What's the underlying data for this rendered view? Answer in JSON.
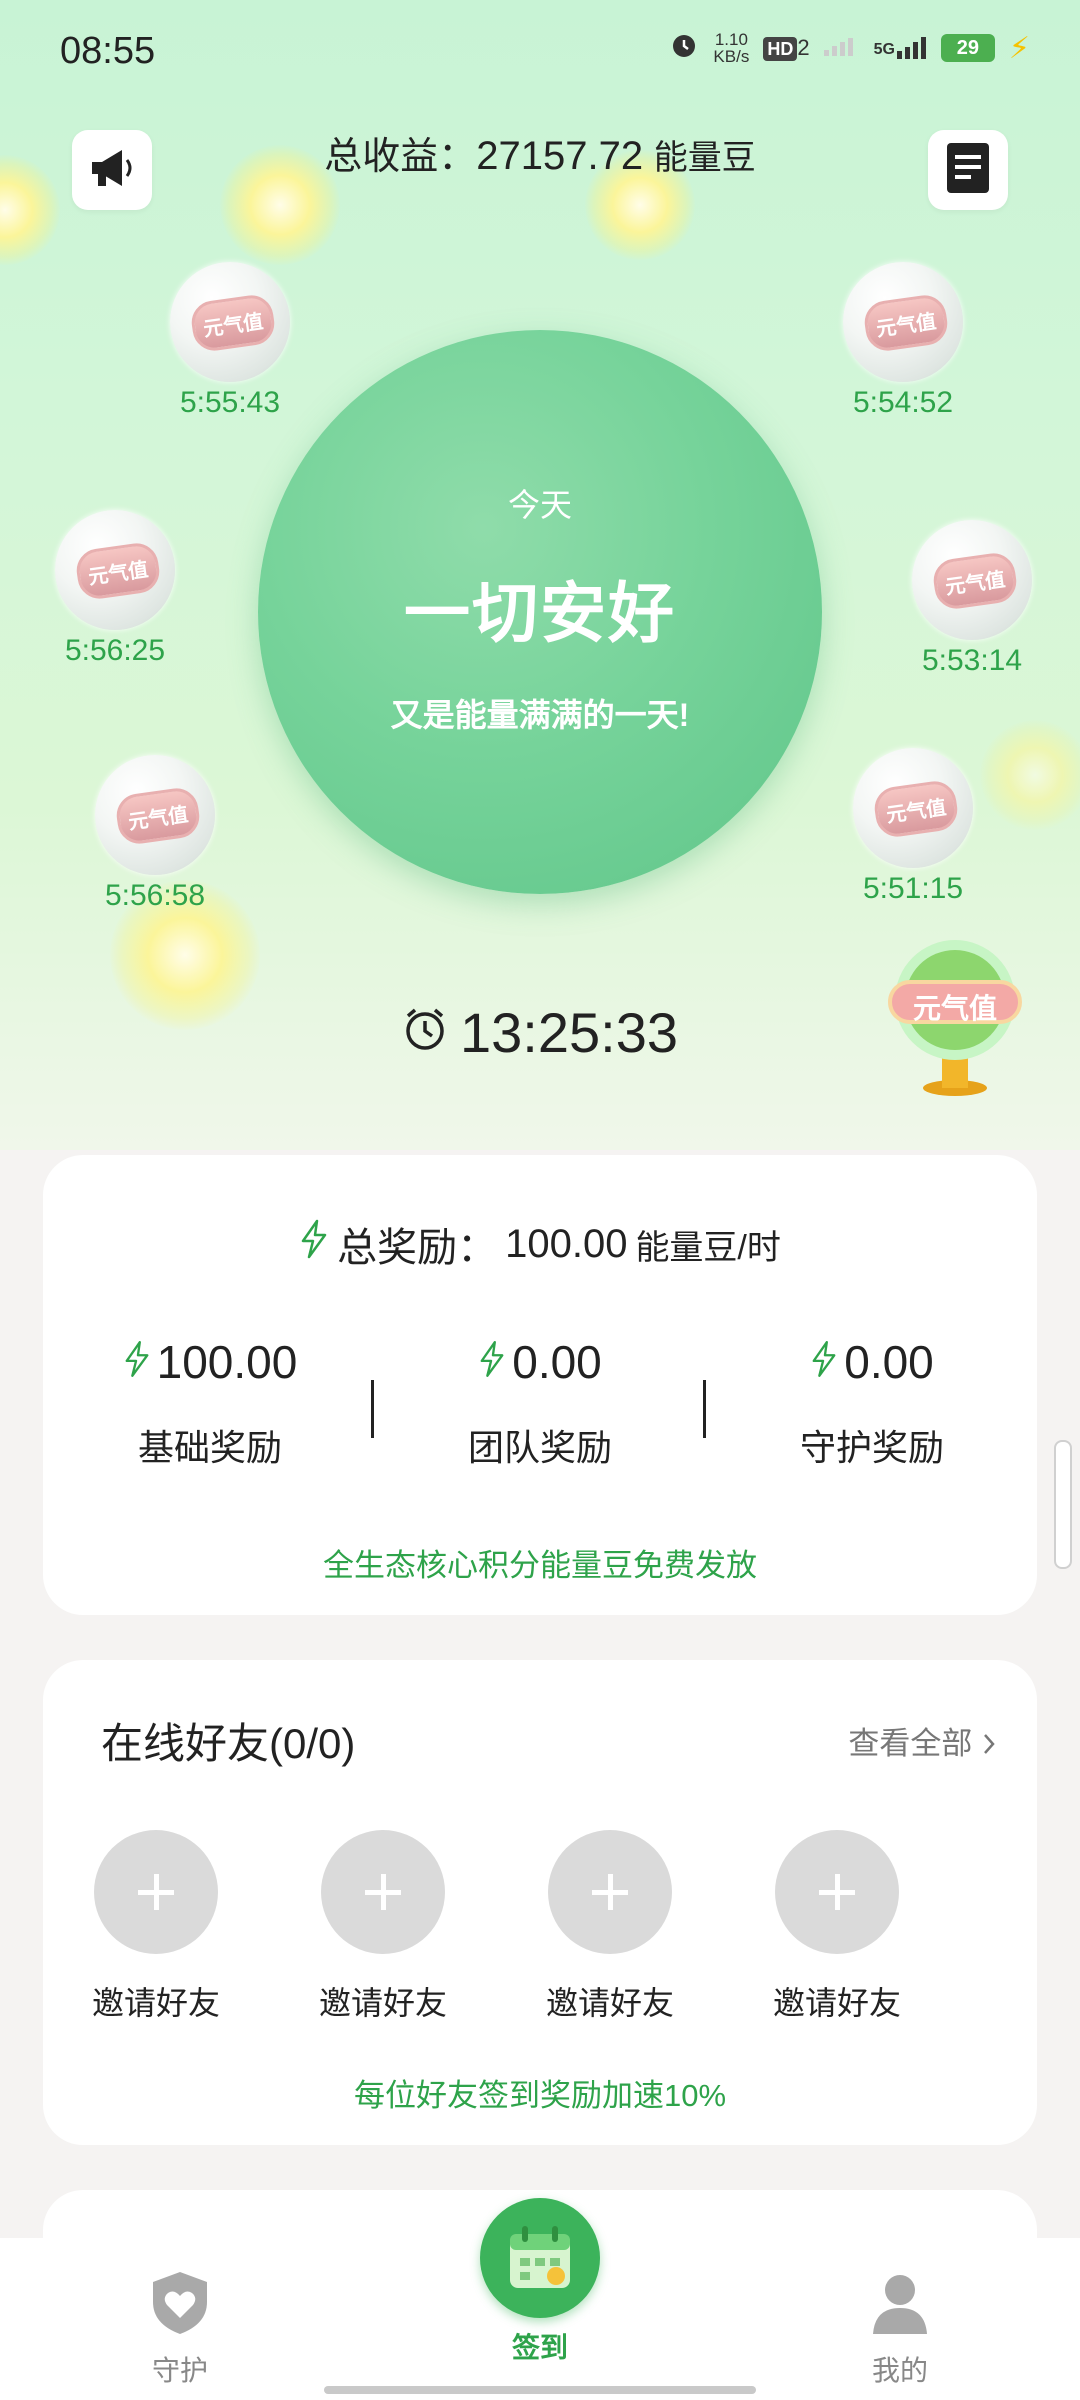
{
  "status_bar": {
    "time": "08:55",
    "net_speed_value": "1.10",
    "net_speed_unit": "KB/s",
    "hd_label": "HD",
    "hd_sub": "2",
    "signal_label": "5G",
    "battery": "29"
  },
  "header": {
    "total_earnings_label": "总收益：",
    "total_earnings_value": "27157.72",
    "total_earnings_unit": "能量豆"
  },
  "bubbles": [
    {
      "badge": "元气值",
      "time": "5:55:43"
    },
    {
      "badge": "元气值",
      "time": "5:54:52"
    },
    {
      "badge": "元气值",
      "time": "5:56:25"
    },
    {
      "badge": "元气值",
      "time": "5:53:14"
    },
    {
      "badge": "元气值",
      "time": "5:56:58"
    },
    {
      "badge": "元气值",
      "time": "5:51:15"
    }
  ],
  "main_circle": {
    "today": "今天",
    "title": "一切安好",
    "subtitle": "又是能量满满的一天!"
  },
  "countdown": "13:25:33",
  "floating_button": {
    "label": "元气值"
  },
  "reward_card": {
    "total_label": "总奖励：",
    "total_value": "100.00",
    "total_unit": "能量豆/时",
    "items": [
      {
        "value": "100.00",
        "label": "基础奖励"
      },
      {
        "value": "0.00",
        "label": "团队奖励"
      },
      {
        "value": "0.00",
        "label": "守护奖励"
      }
    ],
    "note": "全生态核心积分能量豆免费发放"
  },
  "friends_card": {
    "title": "在线好友(0/0)",
    "view_all": "查看全部",
    "invite_label": "邀请好友",
    "slots": [
      "邀请好友",
      "邀请好友",
      "邀请好友",
      "邀请好友"
    ],
    "note": "每位好友签到奖励加速10%"
  },
  "tabbar": {
    "tabs": [
      {
        "label": "守护",
        "icon": "shield-heart-icon",
        "active": false
      },
      {
        "label": "签到",
        "icon": "calendar-icon",
        "active": true
      },
      {
        "label": "我的",
        "icon": "person-icon",
        "active": false
      }
    ]
  },
  "colors": {
    "accent_green": "#2ea34a",
    "circle_green": "#6fcf97",
    "hero_bg": "#d2f6d8",
    "page_bg": "#f5f3f2"
  }
}
